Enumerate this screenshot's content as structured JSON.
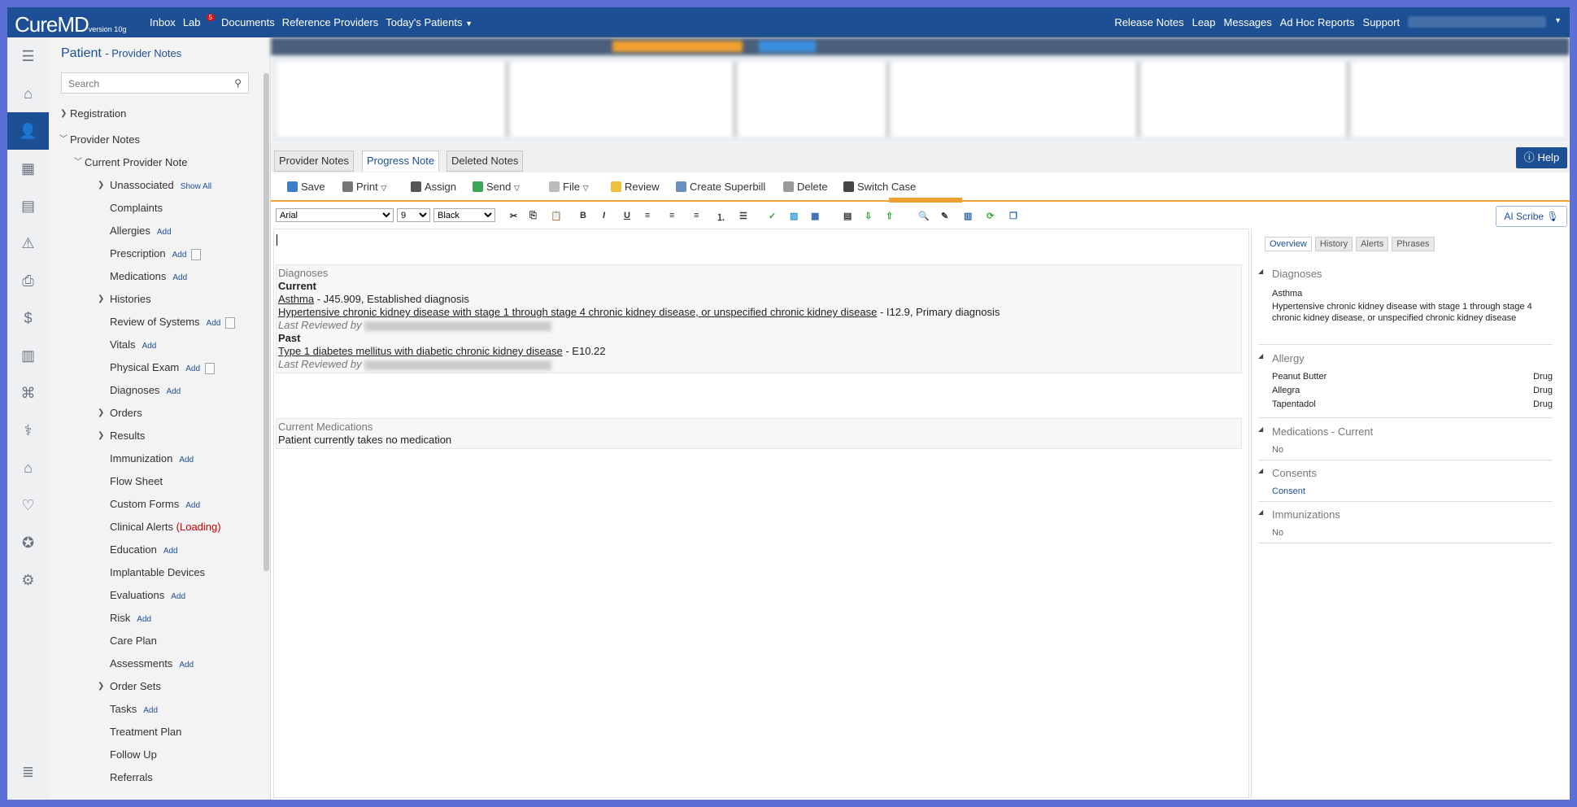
{
  "topbar": {
    "logo": "CureMD",
    "version": "version 10g",
    "nav": [
      "Inbox",
      "Lab",
      "Documents",
      "Reference Providers",
      "Today's Patients"
    ],
    "lab_badge": "5",
    "right": [
      "Release Notes",
      "Leap",
      "Messages",
      "Ad Hoc Reports",
      "Support"
    ]
  },
  "panel": {
    "title": "Patient",
    "subtitle": "- Provider Notes",
    "search_placeholder": "Search"
  },
  "tree": {
    "registration": "Registration",
    "provider_notes": "Provider Notes",
    "current_note": "Current Provider Note",
    "unassociated": "Unassociated",
    "show_all": "Show All",
    "add": "Add",
    "complaints": "Complaints",
    "allergies": "Allergies",
    "prescription": "Prescription",
    "medications": "Medications",
    "histories": "Histories",
    "review_systems": "Review of Systems",
    "vitals": "Vitals",
    "physical_exam": "Physical Exam",
    "diagnoses": "Diagnoses",
    "orders": "Orders",
    "results": "Results",
    "immunization": "Immunization",
    "flow_sheet": "Flow Sheet",
    "custom_forms": "Custom Forms",
    "clinical_alerts": "Clinical Alerts",
    "loading": "(Loading)",
    "education": "Education",
    "implantable": "Implantable Devices",
    "evaluations": "Evaluations",
    "risk": "Risk",
    "care_plan": "Care Plan",
    "assessments": "Assessments",
    "order_sets": "Order Sets",
    "tasks": "Tasks",
    "treatment_plan": "Treatment Plan",
    "follow_up": "Follow Up",
    "referrals": "Referrals"
  },
  "tabs": {
    "provider_notes": "Provider Notes",
    "progress_note": "Progress Note",
    "deleted_notes": "Deleted Notes",
    "help": "Help"
  },
  "toolbar": {
    "save": "Save",
    "print": "Print",
    "assign": "Assign",
    "send": "Send",
    "file": "File",
    "review": "Review",
    "superbill": "Create Superbill",
    "delete": "Delete",
    "switch_case": "Switch Case"
  },
  "format": {
    "font": "Arial",
    "size": "9",
    "color": "Black",
    "ai_scribe": "AI Scribe"
  },
  "note": {
    "diagnoses_title": "Diagnoses",
    "current": "Current",
    "dx1_name": "Asthma",
    "dx1_rest": " - J45.909, Established diagnosis",
    "dx2_name": "Hypertensive chronic kidney disease with stage 1 through stage 4 chronic kidney disease, or unspecified chronic kidney disease",
    "dx2_rest": " - I12.9, Primary diagnosis",
    "last_reviewed": "Last Reviewed by",
    "past": "Past",
    "dx3_name": "Type 1 diabetes mellitus with diabetic chronic kidney disease",
    "dx3_rest": " - E10.22",
    "meds_title": "Current Medications",
    "meds_text": "Patient currently takes no medication"
  },
  "rpanel": {
    "tabs": [
      "Overview",
      "History",
      "Alerts",
      "Phrases"
    ],
    "diagnoses": "Diagnoses",
    "dx1": "Asthma",
    "dx2": "Hypertensive chronic kidney disease with stage 1 through stage 4 chronic kidney disease, or unspecified chronic kidney disease",
    "allergy": "Allergy",
    "allergies": [
      {
        "name": "Peanut Butter",
        "type": "Drug"
      },
      {
        "name": "Allegra",
        "type": "Drug"
      },
      {
        "name": "Tapentadol",
        "type": "Drug"
      }
    ],
    "meds_current": "Medications - Current",
    "no": "No",
    "consents": "Consents",
    "consent": "Consent",
    "immunizations": "Immunizations"
  }
}
